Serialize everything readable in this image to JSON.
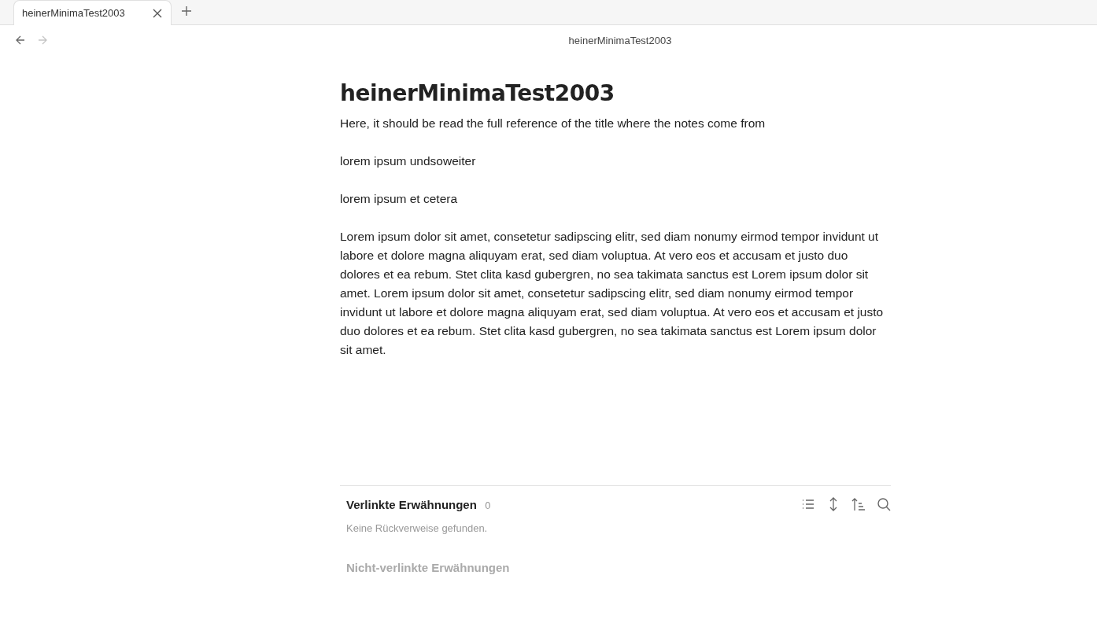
{
  "tabs": [
    {
      "label": "heinerMinimaTest2003",
      "selected": true
    }
  ],
  "nav": {
    "back_disabled": false,
    "forward_disabled": true
  },
  "header_title": "heinerMinimaTest2003",
  "note": {
    "title": "heinerMinimaTest2003",
    "paragraphs": [
      "Here, it should be read the full reference of the title where the notes come from",
      "lorem ipsum undsoweiter",
      "lorem ipsum et cetera",
      "Lorem ipsum dolor sit amet, consetetur sadipscing elitr, sed diam nonumy eirmod tempor invidunt ut labore et dolore magna aliquyam erat, sed diam voluptua. At vero eos et accusam et justo duo dolores et ea rebum. Stet clita kasd gubergren, no sea takimata sanctus est Lorem ipsum dolor sit amet. Lorem ipsum dolor sit amet, consetetur sadipscing elitr, sed diam nonumy eirmod tempor invidunt ut labore et dolore magna aliquyam erat, sed diam voluptua. At vero eos et accusam et justo duo dolores et ea rebum. Stet clita kasd gubergren, no sea takimata sanctus est Lorem ipsum dolor sit amet."
    ]
  },
  "backlinks": {
    "title": "Verlinkte Erwähnungen",
    "count": "0",
    "empty_message": "Keine Rückverweise gefunden.",
    "unlinked_title": "Nicht-verlinkte Erwähnungen"
  }
}
